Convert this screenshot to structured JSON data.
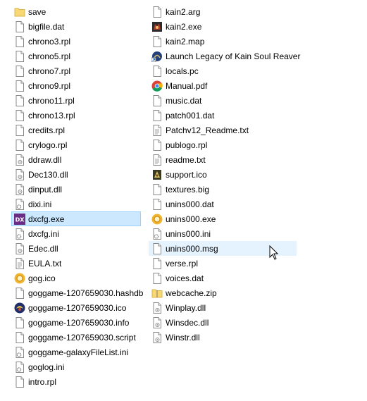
{
  "columns": [
    [
      {
        "label": "save",
        "icon": "folder-icon"
      },
      {
        "label": "bigfile.dat",
        "icon": "file-icon"
      },
      {
        "label": "chrono3.rpl",
        "icon": "file-icon"
      },
      {
        "label": "chrono5.rpl",
        "icon": "file-icon"
      },
      {
        "label": "chrono7.rpl",
        "icon": "file-icon"
      },
      {
        "label": "chrono9.rpl",
        "icon": "file-icon"
      },
      {
        "label": "chrono11.rpl",
        "icon": "file-icon"
      },
      {
        "label": "chrono13.rpl",
        "icon": "file-icon"
      },
      {
        "label": "credits.rpl",
        "icon": "file-icon"
      },
      {
        "label": "crylogo.rpl",
        "icon": "file-icon"
      },
      {
        "label": "ddraw.dll",
        "icon": "dll-icon"
      },
      {
        "label": "Dec130.dll",
        "icon": "dll-icon"
      },
      {
        "label": "dinput.dll",
        "icon": "dll-icon"
      },
      {
        "label": "dixi.ini",
        "icon": "settings-file-icon"
      },
      {
        "label": "dxcfg.exe",
        "icon": "dx-exe-icon",
        "selected": true
      },
      {
        "label": "dxcfg.ini",
        "icon": "settings-file-icon"
      },
      {
        "label": "Edec.dll",
        "icon": "dll-icon"
      },
      {
        "label": "EULA.txt",
        "icon": "text-file-icon"
      },
      {
        "label": "gog.ico",
        "icon": "gog-icon"
      },
      {
        "label": "goggame-1207659030.hashdb",
        "icon": "file-icon"
      },
      {
        "label": "goggame-1207659030.ico",
        "icon": "kain-game-icon"
      },
      {
        "label": "goggame-1207659030.info",
        "icon": "file-icon"
      },
      {
        "label": "goggame-1207659030.script",
        "icon": "file-icon"
      },
      {
        "label": "goggame-galaxyFileList.ini",
        "icon": "settings-file-icon"
      },
      {
        "label": "goglog.ini",
        "icon": "settings-file-icon"
      },
      {
        "label": "intro.rpl",
        "icon": "file-icon"
      }
    ],
    [
      {
        "label": "kain2.arg",
        "icon": "file-icon"
      },
      {
        "label": "kain2.exe",
        "icon": "kain-exe-icon"
      },
      {
        "label": "kain2.map",
        "icon": "file-icon"
      },
      {
        "label": "Launch Legacy of Kain Soul Reaver",
        "icon": "shortcut-icon"
      },
      {
        "label": "locals.pc",
        "icon": "file-icon"
      },
      {
        "label": "Manual.pdf",
        "icon": "chrome-pdf-icon"
      },
      {
        "label": "music.dat",
        "icon": "file-icon"
      },
      {
        "label": "patch001.dat",
        "icon": "file-icon"
      },
      {
        "label": "Patchv12_Readme.txt",
        "icon": "text-file-icon"
      },
      {
        "label": "publogo.rpl",
        "icon": "file-icon"
      },
      {
        "label": "readme.txt",
        "icon": "text-file-icon"
      },
      {
        "label": "support.ico",
        "icon": "support-icon"
      },
      {
        "label": "textures.big",
        "icon": "file-icon"
      },
      {
        "label": "unins000.dat",
        "icon": "file-icon"
      },
      {
        "label": "unins000.exe",
        "icon": "gog-icon"
      },
      {
        "label": "unins000.ini",
        "icon": "settings-file-icon"
      },
      {
        "label": "unins000.msg",
        "icon": "file-icon",
        "hover": true
      },
      {
        "label": "verse.rpl",
        "icon": "file-icon"
      },
      {
        "label": "voices.dat",
        "icon": "file-icon"
      },
      {
        "label": "webcache.zip",
        "icon": "zip-icon"
      },
      {
        "label": "Winplay.dll",
        "icon": "dll-icon"
      },
      {
        "label": "Winsdec.dll",
        "icon": "dll-icon"
      },
      {
        "label": "Winstr.dll",
        "icon": "dll-icon"
      }
    ]
  ],
  "dx_icon_text": "DX",
  "colors": {
    "selection_bg": "#cce8ff",
    "selection_border": "#99d1ff",
    "hover_bg": "#e5f3ff",
    "folder": "#f8d775",
    "gog": "#f1b42f",
    "dx": "#6b2c86"
  }
}
